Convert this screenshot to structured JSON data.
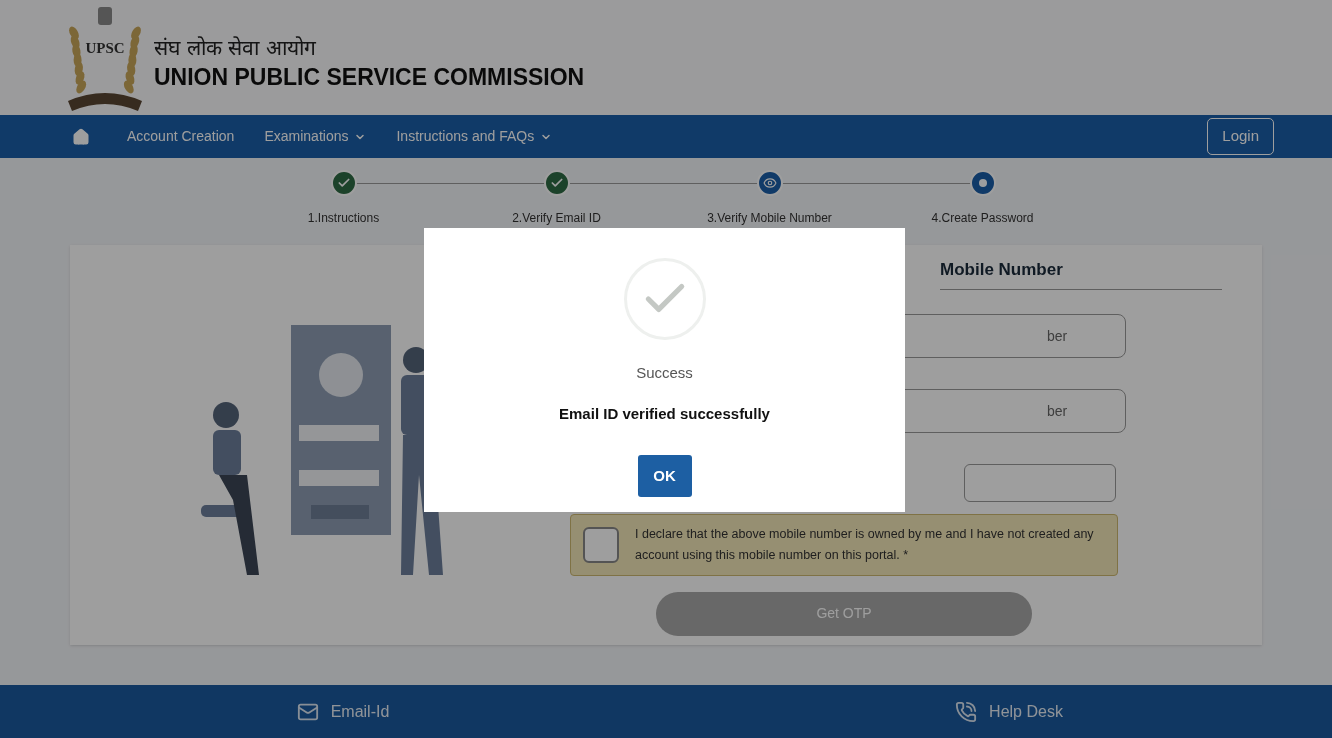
{
  "header": {
    "logo_text": "UPSC",
    "title_hindi": "संघ लोक सेवा आयोग",
    "title": "UNION PUBLIC SERVICE COMMISSION"
  },
  "nav": {
    "items": [
      {
        "label": "Account Creation",
        "dropdown": false
      },
      {
        "label": "Examinations",
        "dropdown": true
      },
      {
        "label": "Instructions and FAQs",
        "dropdown": true
      }
    ],
    "login": "Login"
  },
  "steps": [
    {
      "label": "1.Instructions",
      "kind": "done"
    },
    {
      "label": "2.Verify Email ID",
      "kind": "done"
    },
    {
      "label": "3.Verify Mobile Number",
      "kind": "active"
    },
    {
      "label": "4.Create Password",
      "kind": "pending"
    }
  ],
  "form": {
    "heading": "Mobile Number",
    "fields": [
      {
        "placeholder": "ber"
      },
      {
        "placeholder": "ber"
      }
    ],
    "declaration": {
      "text": "I declare that the above mobile number is owned by me and I have not created any account using this mobile number on this portal. *",
      "checked": false
    },
    "submit": {
      "label": "Get OTP",
      "disabled": true
    }
  },
  "dialog": {
    "title": "Success",
    "message": "Email ID verified successfully",
    "button": "OK"
  },
  "footer": {
    "items": [
      {
        "label": "Email-Id",
        "kind": "mail"
      },
      {
        "label": "Help Desk",
        "kind": "phone"
      }
    ]
  }
}
